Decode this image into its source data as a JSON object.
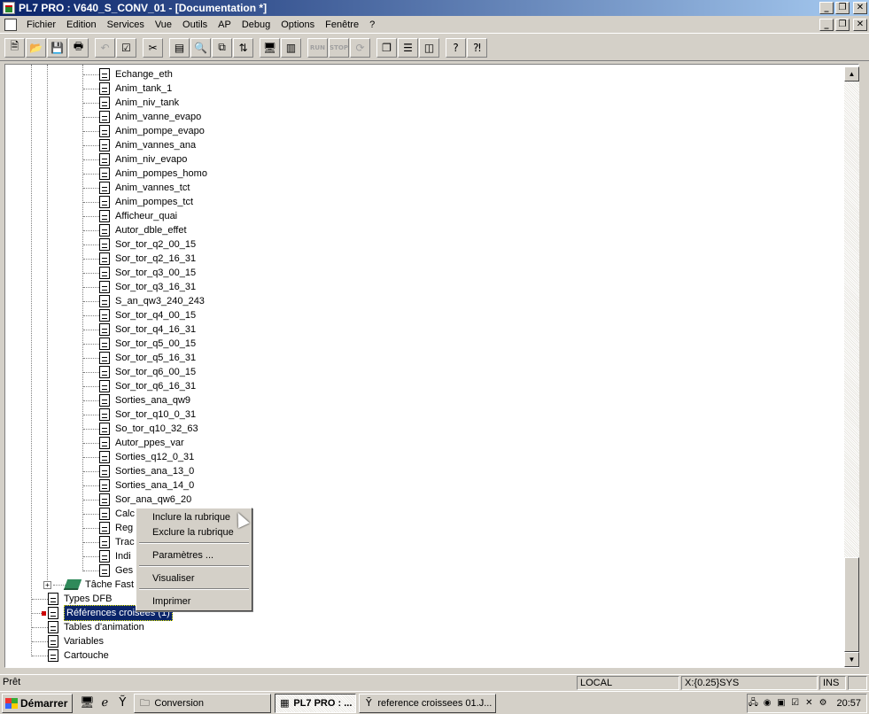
{
  "window": {
    "title": "PL7 PRO : V640_S_CONV_01 - [Documentation *]"
  },
  "menu": [
    "Fichier",
    "Edition",
    "Services",
    "Vue",
    "Outils",
    "AP",
    "Debug",
    "Options",
    "Fenêtre",
    "?"
  ],
  "toolbar": {
    "buttons": [
      {
        "icon": "new-document-icon",
        "glyph": "🗎"
      },
      {
        "icon": "open-folder-icon",
        "glyph": "📂"
      },
      {
        "icon": "save-icon",
        "glyph": "💾"
      },
      {
        "icon": "print-icon",
        "glyph": "🖶"
      },
      {
        "icon": "undo-icon",
        "glyph": "↶"
      },
      {
        "icon": "validate-icon",
        "glyph": "☑"
      },
      {
        "icon": "cut-icon",
        "glyph": "✂"
      },
      {
        "icon": "browser-icon",
        "glyph": "▤"
      },
      {
        "icon": "find-icon",
        "glyph": "🔍"
      },
      {
        "icon": "replace-icon",
        "glyph": "⧉"
      },
      {
        "icon": "transfer-icon",
        "glyph": "⇅"
      },
      {
        "icon": "connect-icon",
        "glyph": "🖥"
      },
      {
        "icon": "animation-table-icon",
        "glyph": "▥"
      },
      {
        "icon": "run-icon",
        "text": "RUN"
      },
      {
        "icon": "stop-icon",
        "text": "STOP"
      },
      {
        "icon": "init-icon",
        "glyph": "⟳"
      },
      {
        "icon": "cascade-windows-icon",
        "glyph": "❐"
      },
      {
        "icon": "tile-horizontal-icon",
        "glyph": "☰"
      },
      {
        "icon": "tile-vertical-icon",
        "glyph": "◫"
      },
      {
        "icon": "help-icon",
        "glyph": "?"
      },
      {
        "icon": "context-help-icon",
        "glyph": "⁈"
      }
    ]
  },
  "tree": {
    "sections": [
      "Echange_eth",
      "Anim_tank_1",
      "Anim_niv_tank",
      "Anim_vanne_evapo",
      "Anim_pompe_evapo",
      "Anim_vannes_ana",
      "Anim_niv_evapo",
      "Anim_pompes_homo",
      "Anim_vannes_tct",
      "Anim_pompes_tct",
      "Afficheur_quai",
      "Autor_dble_effet",
      "Sor_tor_q2_00_15",
      "Sor_tor_q2_16_31",
      "Sor_tor_q3_00_15",
      "Sor_tor_q3_16_31",
      "S_an_qw3_240_243",
      "Sor_tor_q4_00_15",
      "Sor_tor_q4_16_31",
      "Sor_tor_q5_00_15",
      "Sor_tor_q5_16_31",
      "Sor_tor_q6_00_15",
      "Sor_tor_q6_16_31",
      "Sorties_ana_qw9",
      "Sor_tor_q10_0_31",
      "So_tor_q10_32_63",
      "Autor_ppes_var",
      "Sorties_q12_0_31",
      "Sorties_ana_13_0",
      "Sorties_ana_14_0",
      "Sor_ana_qw6_20",
      "Calc",
      "Reg",
      "Trac",
      "Indi",
      "Ges"
    ],
    "fast_task": "Tâche Fast",
    "root_items": [
      "Types DFB",
      "Références croisées (1)",
      "Tables d'animation",
      "Variables",
      "Cartouche"
    ]
  },
  "context_menu": {
    "items": [
      "Inclure la rubrique",
      "Exclure la rubrique",
      "Paramètres ...",
      "Visualiser",
      "Imprimer"
    ]
  },
  "status": {
    "text": "Prêt",
    "mode": "LOCAL",
    "coords": "X:{0.25}SYS",
    "ins": "INS"
  },
  "taskbar": {
    "start": "Démarrer",
    "tasks": [
      "Conversion",
      "PL7 PRO : ...",
      "reference croissees 01.J..."
    ],
    "clock": "20:57"
  }
}
